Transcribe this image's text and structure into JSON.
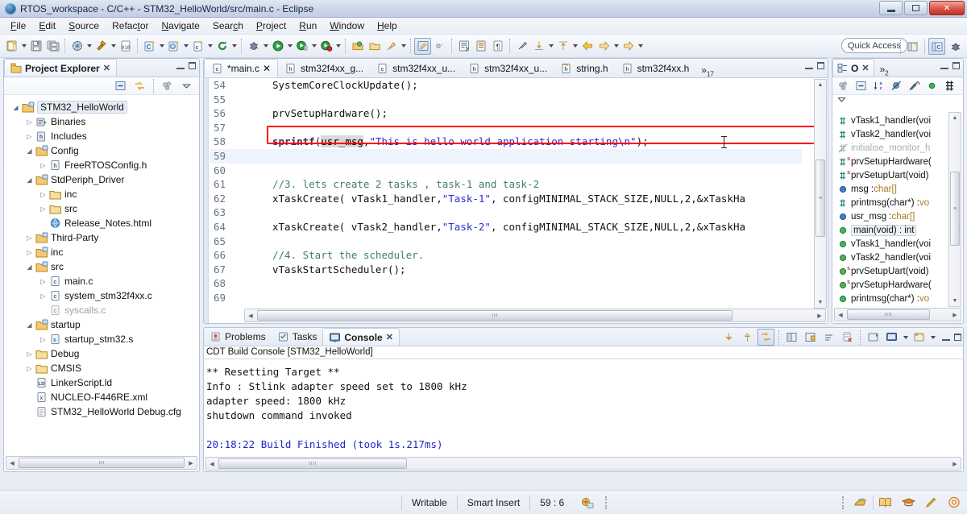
{
  "window": {
    "title": "RTOS_workspace - C/C++ - STM32_HelloWorld/src/main.c - Eclipse",
    "logo_icon": "eclipse-logo-icon",
    "minimize_label": "Minimize",
    "restore_label": "Restore",
    "close_label": "✕"
  },
  "menubar": {
    "items": [
      {
        "label": "File",
        "mnemonic": "F"
      },
      {
        "label": "Edit",
        "mnemonic": "E"
      },
      {
        "label": "Source",
        "mnemonic": "S"
      },
      {
        "label": "Refactor",
        "mnemonic": "t"
      },
      {
        "label": "Navigate",
        "mnemonic": "N"
      },
      {
        "label": "Search",
        "mnemonic": "c"
      },
      {
        "label": "Project",
        "mnemonic": "P"
      },
      {
        "label": "Run",
        "mnemonic": "R"
      },
      {
        "label": "Window",
        "mnemonic": "W"
      },
      {
        "label": "Help",
        "mnemonic": "H"
      }
    ]
  },
  "toolbar": {
    "quick_access": "Quick Access",
    "groups": [
      [
        "new-wizard-icon:dropdown",
        "save-icon",
        "save-all-icon"
      ],
      [
        "build-all-icon:dropdown",
        "build-hammer-icon:dropdown",
        "toggle-build-icon"
      ],
      [
        "new-c-project-icon:dropdown",
        "new-cpp-class-icon:dropdown",
        "new-c-file-icon:dropdown",
        "refresh-green-icon:dropdown"
      ],
      [
        "debug-icon:dropdown",
        "run-icon:dropdown",
        "run-external-icon:dropdown",
        "profile-icon:dropdown"
      ],
      [
        "open-type-icon",
        "open-resource-icon",
        "skip-breakpoints-icon:dropdown"
      ],
      [
        "toggle-mark-occurrences-icon",
        "toggle-block-selection-icon"
      ],
      [
        "open-element-icon",
        "open-include-icon",
        "show-whitespace-icon"
      ],
      [
        "pin-editor-icon",
        "next-annotation-icon:dropdown",
        "previous-annotation-icon:dropdown",
        "back-icon",
        "forward-icon:dropdown",
        "last-edit-icon:dropdown"
      ]
    ],
    "perspective_buttons": [
      "open-perspective-icon",
      "cpp-perspective-icon",
      "debug-perspective-icon"
    ]
  },
  "project_explorer": {
    "tab_label": "Project Explorer",
    "tab_icon": "project-explorer-icon",
    "close_icon": "✕",
    "toolbar_icons": [
      "collapse-all-icon",
      "link-with-editor-icon",
      "focus-on-active-task-icon",
      "view-menu-icon"
    ],
    "tree": [
      {
        "indent": 0,
        "arrow": "expanded",
        "icon": "project-folder-icon",
        "label": "STM32_HelloWorld",
        "selected": true
      },
      {
        "indent": 1,
        "arrow": "collapsed",
        "icon": "binaries-icon",
        "label": "Binaries"
      },
      {
        "indent": 1,
        "arrow": "collapsed",
        "icon": "includes-icon",
        "label": "Includes"
      },
      {
        "indent": 1,
        "arrow": "expanded",
        "icon": "source-folder-icon",
        "label": "Config"
      },
      {
        "indent": 2,
        "arrow": "collapsed",
        "icon": "header-file-icon",
        "label": "FreeRTOSConfig.h"
      },
      {
        "indent": 1,
        "arrow": "expanded",
        "icon": "source-folder-icon",
        "label": "StdPeriph_Driver"
      },
      {
        "indent": 2,
        "arrow": "collapsed",
        "icon": "folder-icon",
        "label": "inc"
      },
      {
        "indent": 2,
        "arrow": "collapsed",
        "icon": "folder-icon",
        "label": "src"
      },
      {
        "indent": 2,
        "arrow": "none",
        "icon": "html-file-icon",
        "label": "Release_Notes.html"
      },
      {
        "indent": 1,
        "arrow": "collapsed",
        "icon": "source-folder-icon",
        "label": "Third-Party"
      },
      {
        "indent": 1,
        "arrow": "collapsed",
        "icon": "source-folder-icon",
        "label": "inc"
      },
      {
        "indent": 1,
        "arrow": "expanded",
        "icon": "source-folder-icon",
        "label": "src"
      },
      {
        "indent": 2,
        "arrow": "collapsed",
        "icon": "c-file-icon",
        "label": "main.c"
      },
      {
        "indent": 2,
        "arrow": "collapsed",
        "icon": "c-file-icon",
        "label": "system_stm32f4xx.c"
      },
      {
        "indent": 2,
        "arrow": "none",
        "icon": "c-file-excluded-icon",
        "label": "syscalls.c",
        "muted": true
      },
      {
        "indent": 1,
        "arrow": "expanded",
        "icon": "source-folder-icon",
        "label": "startup"
      },
      {
        "indent": 2,
        "arrow": "collapsed",
        "icon": "asm-file-icon",
        "label": "startup_stm32.s"
      },
      {
        "indent": 1,
        "arrow": "collapsed",
        "icon": "folder-icon",
        "label": "Debug"
      },
      {
        "indent": 1,
        "arrow": "collapsed",
        "icon": "folder-icon",
        "label": "CMSIS"
      },
      {
        "indent": 1,
        "arrow": "none",
        "icon": "linker-script-icon",
        "label": "LinkerScript.ld"
      },
      {
        "indent": 1,
        "arrow": "none",
        "icon": "xml-file-icon",
        "label": "NUCLEO-F446RE.xml"
      },
      {
        "indent": 1,
        "arrow": "none",
        "icon": "cfg-file-icon",
        "label": "STM32_HelloWorld Debug.cfg"
      }
    ]
  },
  "editor": {
    "tabs": [
      {
        "label": "*main.c",
        "icon": "c-file-icon",
        "active": true,
        "closable": true
      },
      {
        "label": "stm32f4xx_g...",
        "icon": "header-file-icon",
        "active": false
      },
      {
        "label": "stm32f4xx_u...",
        "icon": "c-file-icon",
        "active": false
      },
      {
        "label": "stm32f4xx_u...",
        "icon": "header-file-icon",
        "active": false
      },
      {
        "label": "string.h",
        "icon": "header-file-readonly-icon",
        "active": false
      },
      {
        "label": "stm32f4xx.h",
        "icon": "header-file-icon",
        "active": false
      }
    ],
    "overflow_label": "»",
    "overflow_count": "17",
    "lines": [
      {
        "num": "54",
        "tokens": [
          {
            "t": "SystemCoreClockUpdate();",
            "c": "plain"
          }
        ]
      },
      {
        "num": "55",
        "tokens": []
      },
      {
        "num": "56",
        "tokens": [
          {
            "t": "prvSetupHardware();",
            "c": "plain"
          }
        ]
      },
      {
        "num": "57",
        "tokens": []
      },
      {
        "num": "58",
        "highlight_box": true,
        "tokens": [
          {
            "t": "sprintf",
            "c": "fn"
          },
          {
            "t": "(",
            "c": "plain"
          },
          {
            "t": "usr_msg",
            "c": "var"
          },
          {
            "t": ",",
            "c": "plain"
          },
          {
            "t": "\"This is hello world application starting\\n\"",
            "c": "str"
          },
          {
            "t": ");",
            "c": "plain"
          }
        ]
      },
      {
        "num": "59",
        "caret_line": true,
        "tokens": []
      },
      {
        "num": "60",
        "tokens": []
      },
      {
        "num": "61",
        "tokens": [
          {
            "t": "//3. lets create 2 tasks , task-1 and task-2",
            "c": "cmt"
          }
        ]
      },
      {
        "num": "62",
        "tokens": [
          {
            "t": "xTaskCreate( vTask1_handler,",
            "c": "plain"
          },
          {
            "t": "\"Task-1\"",
            "c": "str"
          },
          {
            "t": ", configMINIMAL_STACK_SIZE,NULL,2,&xTaskHa",
            "c": "plain"
          }
        ]
      },
      {
        "num": "63",
        "tokens": []
      },
      {
        "num": "64",
        "tokens": [
          {
            "t": "xTaskCreate( vTask2_handler,",
            "c": "plain"
          },
          {
            "t": "\"Task-2\"",
            "c": "str"
          },
          {
            "t": ", configMINIMAL_STACK_SIZE,NULL,2,&xTaskHa",
            "c": "plain"
          }
        ]
      },
      {
        "num": "65",
        "tokens": []
      },
      {
        "num": "66",
        "tokens": [
          {
            "t": "//4. Start the scheduler.",
            "c": "cmt"
          }
        ]
      },
      {
        "num": "67",
        "tokens": [
          {
            "t": "vTaskStartScheduler();",
            "c": "plain"
          }
        ]
      },
      {
        "num": "68",
        "tokens": []
      },
      {
        "num": "69",
        "tokens": []
      }
    ],
    "highlight_color": "#ff0000"
  },
  "outline": {
    "tab_label": "O",
    "tab_icon": "outline-icon",
    "close_icon": "✕",
    "overflow_label": "»",
    "overflow_count": "2",
    "toolbar_icons": [
      "focus-active-task-icon",
      "collapse-all-icon",
      "sort-alphabetically-icon",
      "hide-fields-icon",
      "hide-static-icon",
      "hide-nonpublic-icon",
      "filters-icon",
      "view-menu-icon"
    ],
    "items": [
      {
        "icon": "include-icon",
        "label": "vTask1_handler(voi"
      },
      {
        "icon": "include-icon",
        "label": "vTask2_handler(voi"
      },
      {
        "icon": "include-disabled-icon",
        "label": "initialise_monitor_h",
        "muted": true
      },
      {
        "icon": "include-icon",
        "label": "prvSetupHardware(",
        "static": true
      },
      {
        "icon": "include-icon",
        "label": "prvSetupUart(void)",
        "static": true
      },
      {
        "icon": "variable-icon",
        "label": "msg : ",
        "type": "char[]"
      },
      {
        "icon": "include-icon",
        "label": "printmsg(char*) : ",
        "type": "vo"
      },
      {
        "icon": "variable-icon",
        "label": "usr_msg : ",
        "type": "char[]"
      },
      {
        "icon": "function-icon",
        "label": "main(void) : int",
        "selected": true
      },
      {
        "icon": "function-icon",
        "label": "vTask1_handler(voi"
      },
      {
        "icon": "function-icon",
        "label": "vTask2_handler(voi"
      },
      {
        "icon": "function-icon",
        "label": "prvSetupUart(void)",
        "static": true
      },
      {
        "icon": "function-icon",
        "label": "prvSetupHardware(",
        "static": true
      },
      {
        "icon": "function-icon",
        "label": "printmsg(char*) : ",
        "type": "vo"
      }
    ]
  },
  "console": {
    "tabs": [
      {
        "label": "Problems",
        "icon": "problems-icon",
        "active": false
      },
      {
        "label": "Tasks",
        "icon": "tasks-icon",
        "active": false
      },
      {
        "label": "Console",
        "icon": "console-icon",
        "active": true,
        "closable": true
      }
    ],
    "close_icon": "✕",
    "toolbar_icons": [
      "scroll-lock-down-icon",
      "scroll-lock-up-icon",
      "pin-console-icon",
      "display-selected-console-icon",
      "lock-console-icon",
      "word-wrap-icon",
      "clear-console-icon",
      "new-console-view-icon",
      "open-console-icon:dropdown",
      "console-options-icon:dropdown"
    ],
    "title": "CDT Build Console [STM32_HelloWorld]",
    "lines": [
      {
        "text": "** Resetting Target **",
        "color": "plain"
      },
      {
        "text": "Info : Stlink adapter speed set to 1800 kHz",
        "color": "plain"
      },
      {
        "text": "adapter speed: 1800 kHz",
        "color": "plain"
      },
      {
        "text": "shutdown command invoked",
        "color": "plain"
      },
      {
        "text": "",
        "color": "plain"
      },
      {
        "text": "20:18:22 Build Finished (took 1s.217ms)",
        "color": "blue"
      }
    ]
  },
  "statusbar": {
    "writable": "Writable",
    "insert_mode": "Smart Insert",
    "cursor_position": "59 : 6",
    "build_icon": "build-status-icon",
    "right_icons": [
      "perspective-switcher-icon",
      "book-icon",
      "graduation-cap-icon",
      "pencil-icon",
      "target-icon"
    ]
  }
}
